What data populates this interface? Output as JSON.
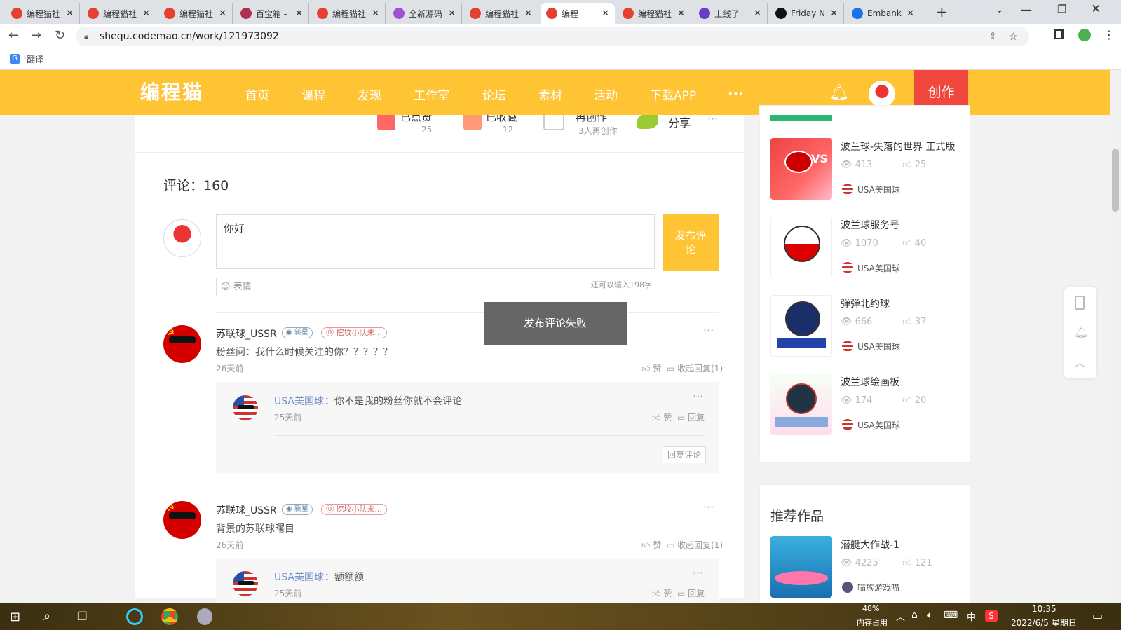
{
  "browser": {
    "tabs": [
      {
        "title": "编程猫社",
        "fav": "#e6402e"
      },
      {
        "title": "编程猫社",
        "fav": "#e6402e"
      },
      {
        "title": "编程猫社",
        "fav": "#e6402e"
      },
      {
        "title": "百宝箱 -",
        "fav": "#b03050"
      },
      {
        "title": "编程猫社",
        "fav": "#e6402e"
      },
      {
        "title": "全新源码",
        "fav": "#a050d0"
      },
      {
        "title": "编程猫社",
        "fav": "#e6402e"
      },
      {
        "title": "编程",
        "fav": "#e6402e"
      },
      {
        "title": "编程猫社",
        "fav": "#e6402e"
      },
      {
        "title": "上线了",
        "fav": "#6a3cc8"
      },
      {
        "title": "Friday N",
        "fav": "#111111"
      },
      {
        "title": "Embank",
        "fav": "#1a73e8"
      }
    ],
    "url": "shequ.codemao.cn/work/121973092",
    "bookmark_translate": "翻译"
  },
  "site": {
    "logo": "编程猫",
    "nav": [
      "首页",
      "课程",
      "发现",
      "工作室",
      "论坛",
      "素材",
      "活动",
      "下载APP"
    ],
    "nav_more": "···",
    "create": "创作"
  },
  "work_actions": {
    "liked_label": "已点赞",
    "liked_count": "25",
    "fav_label": "已收藏",
    "fav_count": "12",
    "remix_label": "再创作",
    "remix_count": "3人再创作",
    "share_label": "分享"
  },
  "comments": {
    "header": "评论：160",
    "input_value": "你好",
    "submit_label": "发布评论",
    "emoji_label": "表情",
    "remaining": "还可以输入198字",
    "toast": "发布评论失败",
    "items": [
      {
        "user": "苏联球_USSR",
        "badge_new": "新星",
        "badge_team": "挖坟小队未...",
        "text": "粉丝问：我什么时候关注的你？？？？？",
        "time": "26天前",
        "like": "赞",
        "collapse": "收起回复(1)",
        "reply": {
          "user": "USA美国球",
          "text": "：你不是我的粉丝你就不会评论",
          "time": "25天前",
          "like": "赞",
          "reply": "回复",
          "reply_btn": "回复评论"
        }
      },
      {
        "user": "苏联球_USSR",
        "badge_new": "新星",
        "badge_team": "挖坟小队未...",
        "text": "背景的苏联球曙目",
        "time": "26天前",
        "like": "赞",
        "collapse": "收起回复(1)",
        "reply": {
          "user": "USA美国球",
          "text": "：额额额",
          "time": "25天前",
          "like": "赞",
          "reply": "回复"
        }
      }
    ]
  },
  "sidebar": {
    "works": [
      {
        "title": "波兰球-失落的世界 正式版",
        "views": "413",
        "likes": "25",
        "author": "USA美国球"
      },
      {
        "title": "波兰球服务号",
        "views": "1070",
        "likes": "40",
        "author": "USA美国球"
      },
      {
        "title": "弹弹北约球",
        "views": "666",
        "likes": "37",
        "author": "USA美国球"
      },
      {
        "title": "波兰球绘画板",
        "views": "174",
        "likes": "20",
        "author": "USA美国球"
      }
    ],
    "recommend_title": "推荐作品",
    "recommend": [
      {
        "title": "潜艇大作战-1",
        "views": "4225",
        "likes": "121",
        "author": "喵族游戏喵"
      }
    ]
  },
  "taskbar": {
    "mem_pct": "48%",
    "mem_label": "内存占用",
    "ime": "中",
    "time": "10:35",
    "date": "2022/6/5 星期日"
  }
}
